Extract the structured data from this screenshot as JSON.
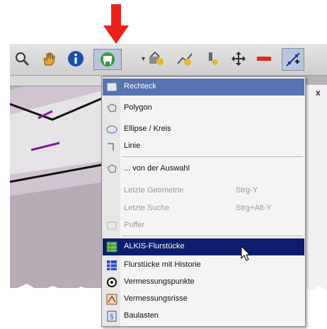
{
  "colors": {
    "annotation_arrow": "#e8221b",
    "menu_highlight": "#5574b0",
    "menu_selected": "#0c1d6e"
  },
  "toolbar": {
    "icons": [
      "zoom-icon",
      "pan-hand-icon",
      "info-icon",
      "selection-tool-icon",
      "tool-icon-1",
      "tool-icon-2",
      "tool-icon-3",
      "move-icon",
      "remove-icon",
      "add-point-icon"
    ],
    "dropdown_indicator": "▾"
  },
  "map": {
    "close_glyph": "x"
  },
  "menu": {
    "items": [
      {
        "label": "Rechteck",
        "icon": "rectangle-icon"
      },
      {
        "label": "Polygon",
        "icon": "polygon-icon"
      },
      {
        "label": "Ellipse / Kreis",
        "icon": "ellipse-icon"
      },
      {
        "label": "Linie",
        "icon": "line-icon"
      },
      {
        "label": "... von der Auswahl",
        "icon": "polygon-icon"
      },
      {
        "label": "Letzte Geometrie",
        "shortcut": "Strg-Y",
        "disabled": true
      },
      {
        "label": "Letzte Suche",
        "shortcut": "Strg+Alt-Y",
        "disabled": true
      },
      {
        "label": "Puffer",
        "icon": "buffer-icon",
        "disabled": true
      },
      {
        "label": "ALKIS-Flurstücke",
        "icon": "parcel-icon"
      },
      {
        "label": "Flurstücke mit Historie",
        "icon": "parcel-history-icon"
      },
      {
        "label": "Vermessungspunkte",
        "icon": "survey-point-icon"
      },
      {
        "label": "Vermessungsrisse",
        "icon": "survey-sketch-icon"
      },
      {
        "label": "Baulasten",
        "icon": "baulast-icon"
      }
    ]
  }
}
